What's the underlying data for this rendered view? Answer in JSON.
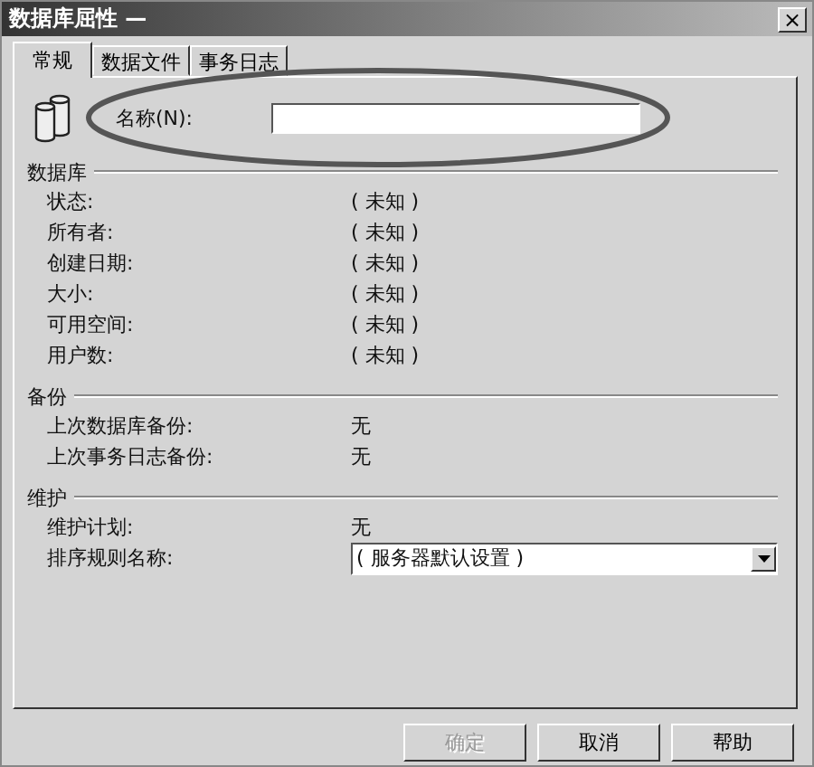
{
  "window": {
    "title": "数据库屈性 —",
    "close": "×"
  },
  "tabs": [
    {
      "label": "常规",
      "selected": true
    },
    {
      "label": "数据文件",
      "selected": false
    },
    {
      "label": "事务日志",
      "selected": false
    }
  ],
  "name_field": {
    "label": "名称(N):"
  },
  "sections": [
    {
      "title": "数据库",
      "rows": [
        {
          "kind": "text",
          "label": "状态:",
          "value": "( 未知 )"
        },
        {
          "kind": "text",
          "label": "所有者:",
          "value": "( 未知 )"
        },
        {
          "kind": "text",
          "label": "创建日期:",
          "value": "( 未知 )"
        },
        {
          "kind": "text",
          "label": "大小:",
          "value": "( 未知 )"
        },
        {
          "kind": "text",
          "label": "可用空间:",
          "value": "( 未知 )"
        },
        {
          "kind": "text",
          "label": "用户数:",
          "value": "( 未知 )"
        }
      ]
    },
    {
      "title": "备份",
      "rows": [
        {
          "kind": "text",
          "label": "上次数据库备份:",
          "value": "无"
        },
        {
          "kind": "text",
          "label": "上次事务日志备份:",
          "value": "无"
        }
      ]
    },
    {
      "title": "维护",
      "rows": [
        {
          "kind": "text",
          "label": "维护计划:",
          "value": "无"
        },
        {
          "kind": "dropdown",
          "label": "排序规则名称:",
          "value": "( 服务器默认设置 )"
        }
      ]
    }
  ],
  "buttons": [
    {
      "label": "确定",
      "disabled": true
    },
    {
      "label": "取消",
      "disabled": false
    },
    {
      "label": "帮助",
      "disabled": false
    }
  ]
}
